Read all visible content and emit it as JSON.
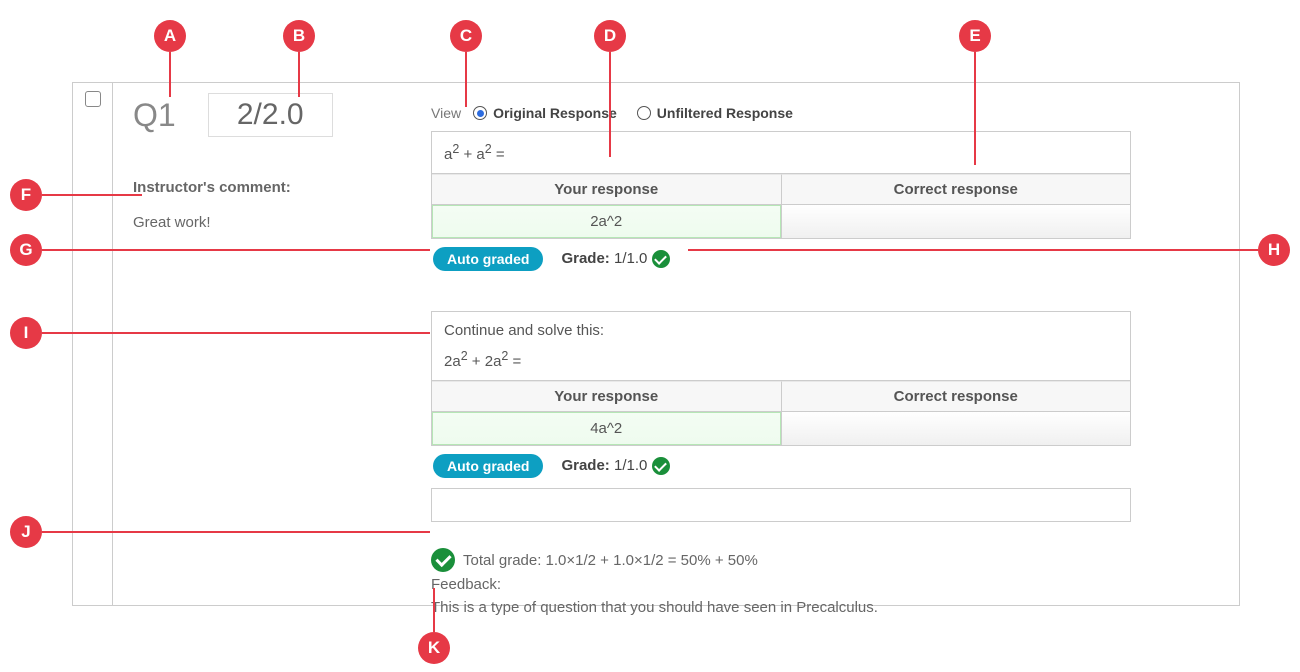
{
  "callouts": {
    "A": "A",
    "B": "B",
    "C": "C",
    "D": "D",
    "E": "E",
    "F": "F",
    "G": "G",
    "H": "H",
    "I": "I",
    "J": "J",
    "K": "K"
  },
  "question": {
    "label": "Q1",
    "score": "2/2.0",
    "instructor_label": "Instructor's comment:",
    "instructor_comment": "Great work!"
  },
  "view": {
    "label": "View",
    "original": "Original Response",
    "unfiltered": "Unfiltered Response"
  },
  "parts": [
    {
      "prompt_html": "a<sup>2</sup> + a<sup>2</sup> =",
      "your_header": "Your response",
      "correct_header": "Correct response",
      "your_response": "2a^2",
      "correct_response": "",
      "auto_label": "Auto graded",
      "grade_label": "Grade:",
      "grade_value": "1/1.0"
    },
    {
      "intro": "Continue and solve this:",
      "prompt_html": "2a<sup>2</sup> + 2a<sup>2</sup> =",
      "your_header": "Your response",
      "correct_header": "Correct response",
      "your_response": "4a^2",
      "correct_response": "",
      "auto_label": "Auto graded",
      "grade_label": "Grade:",
      "grade_value": "1/1.0"
    }
  ],
  "total": {
    "label": "Total grade: 1.0×1/2 + 1.0×1/2 = 50% + 50%"
  },
  "feedback": {
    "label": "Feedback:",
    "text": "This is a type of question that you should have seen in Precalculus."
  }
}
